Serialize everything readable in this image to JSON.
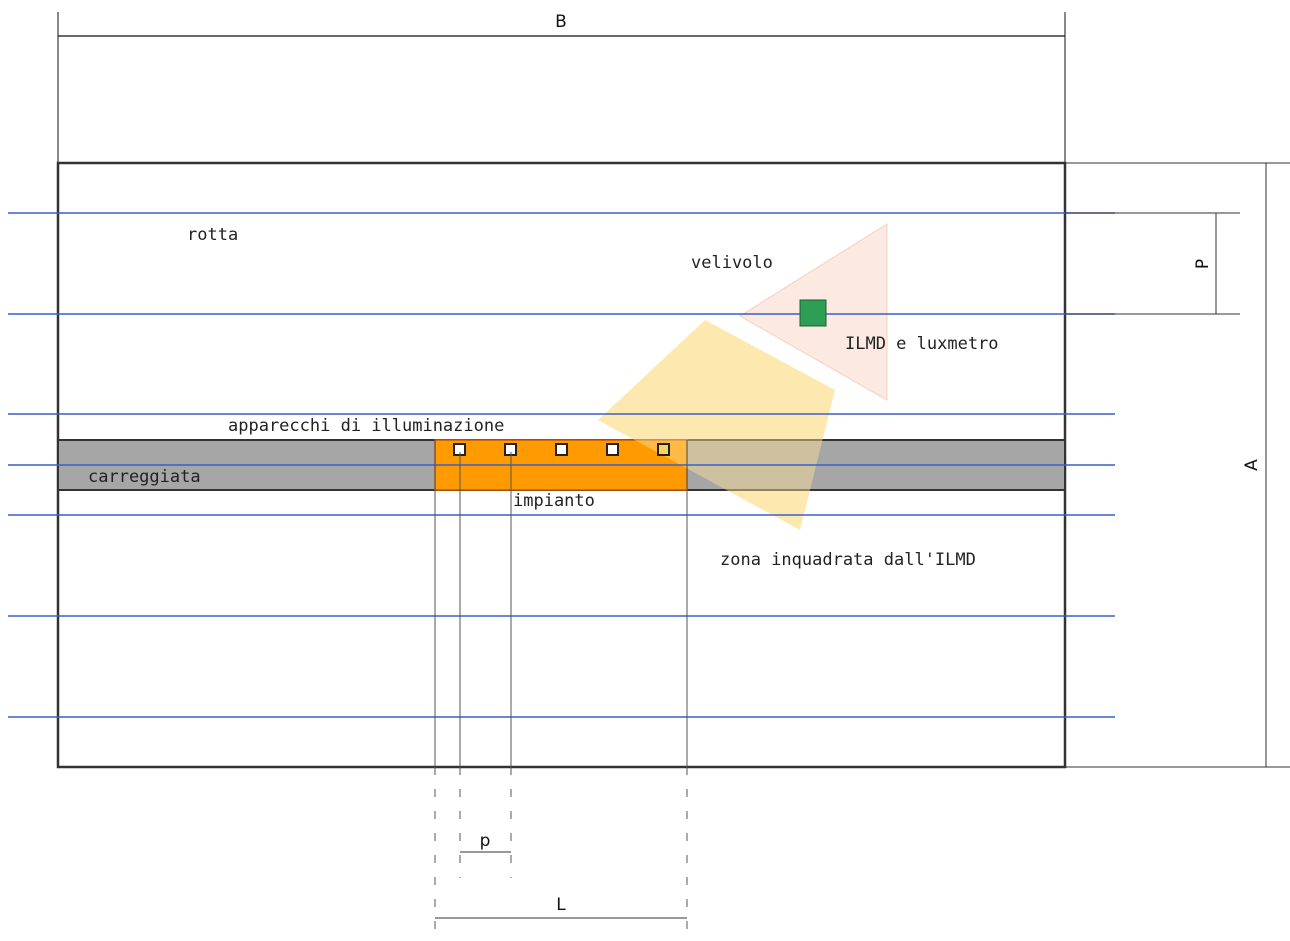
{
  "dimensions": {
    "width_label": "B",
    "height_label": "A",
    "pass_spacing_label": "P",
    "luminaire_spacing_label": "p",
    "installation_length_label": "L"
  },
  "labels": {
    "route": "rotta",
    "aircraft": "velivolo",
    "instrument": "ILMD e luxmetro",
    "luminaires": "apparecchi di illuminazione",
    "roadway": "carreggiata",
    "installation": "impianto",
    "framed_zone": "zona inquadrata dall'ILMD"
  },
  "colors": {
    "flight_line": "#3a5fc8",
    "roadway": "#a6a6a6",
    "installation": "#ff9a00",
    "framed_zone": "#fde39a",
    "aircraft_cone": "#f8c8b0",
    "instrument": "#2e9e55",
    "border": "#333333"
  },
  "luminaire_count": 5
}
